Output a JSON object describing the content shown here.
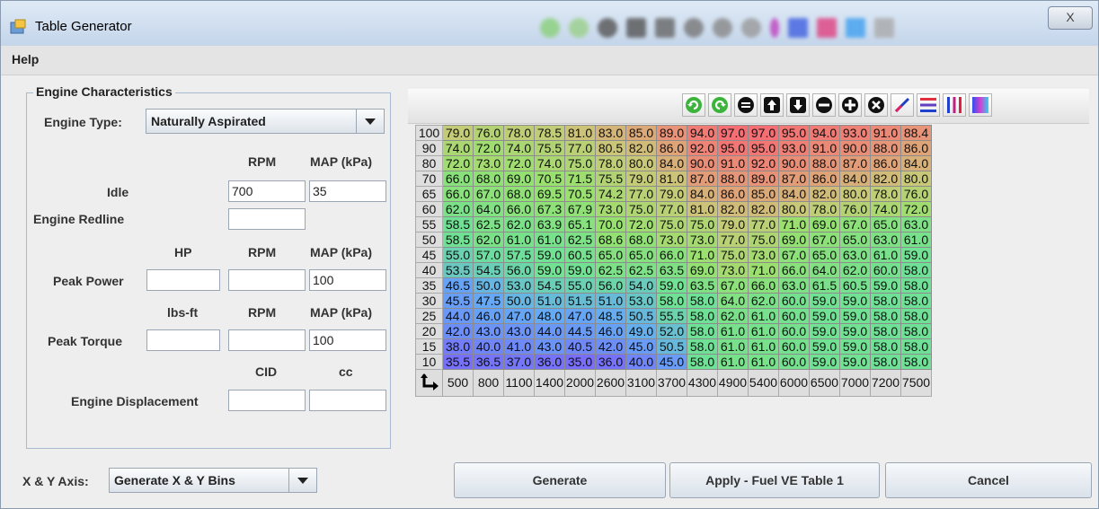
{
  "window": {
    "title": "Table Generator",
    "close_glyph": "X"
  },
  "menu": {
    "help": "Help"
  },
  "engine": {
    "group_title": "Engine Characteristics",
    "engine_type_label": "Engine Type:",
    "engine_type_value": "Naturally Aspirated",
    "col_rpm": "RPM",
    "col_map": "MAP (kPa)",
    "col_hp": "HP",
    "col_lbsft": "lbs-ft",
    "col_cid": "CID",
    "col_cc": "cc",
    "idle_label": "Idle",
    "idle_rpm": "700",
    "idle_map": "35",
    "redline_label": "Engine Redline",
    "redline_rpm": "",
    "peak_power_label": "Peak Power",
    "peak_power_hp": "",
    "peak_power_rpm": "",
    "peak_power_map": "100",
    "peak_torque_label": "Peak Torque",
    "peak_torque_lbsft": "",
    "peak_torque_rpm": "",
    "peak_torque_map": "100",
    "displacement_label": "Engine Displacement",
    "displacement_cid": "",
    "displacement_cc": ""
  },
  "axis": {
    "label": "X & Y Axis:",
    "value": "Generate X & Y Bins"
  },
  "buttons": {
    "generate": "Generate",
    "apply": "Apply - Fuel VE Table 1",
    "cancel": "Cancel"
  },
  "toolbar_icons": [
    "rotate-left-icon",
    "rotate-right-icon",
    "equal-icon",
    "arrow-up-icon",
    "arrow-down-icon",
    "minus-icon",
    "plus-icon",
    "multiply-icon",
    "interpolate-pen-icon",
    "horizontal-lines-icon",
    "vertical-lines-icon",
    "color-gradient-icon"
  ],
  "table": {
    "y_bins": [
      "100",
      "90",
      "80",
      "70",
      "65",
      "60",
      "55",
      "50",
      "45",
      "40",
      "35",
      "30",
      "25",
      "20",
      "15",
      "10"
    ],
    "x_bins": [
      "500",
      "800",
      "1100",
      "1400",
      "2000",
      "2600",
      "3100",
      "3700",
      "4300",
      "4900",
      "5400",
      "6000",
      "6500",
      "7000",
      "7200",
      "7500"
    ],
    "rows": [
      [
        "79.0",
        "76.0",
        "78.0",
        "78.5",
        "81.0",
        "83.0",
        "85.0",
        "89.0",
        "94.0",
        "97.0",
        "97.0",
        "95.0",
        "94.0",
        "93.0",
        "91.0",
        "88.4"
      ],
      [
        "74.0",
        "72.0",
        "74.0",
        "75.5",
        "77.0",
        "80.5",
        "82.0",
        "86.0",
        "92.0",
        "95.0",
        "95.0",
        "93.0",
        "91.0",
        "90.0",
        "88.0",
        "86.0"
      ],
      [
        "72.0",
        "73.0",
        "72.0",
        "74.0",
        "75.0",
        "78.0",
        "80.0",
        "84.0",
        "90.0",
        "91.0",
        "92.0",
        "90.0",
        "88.0",
        "87.0",
        "86.0",
        "84.0"
      ],
      [
        "66.0",
        "68.0",
        "69.0",
        "70.5",
        "71.5",
        "75.5",
        "79.0",
        "81.0",
        "87.0",
        "88.0",
        "89.0",
        "87.0",
        "86.0",
        "84.0",
        "82.0",
        "80.0"
      ],
      [
        "66.0",
        "67.0",
        "68.0",
        "69.5",
        "70.5",
        "74.2",
        "77.0",
        "79.0",
        "84.0",
        "86.0",
        "85.0",
        "84.0",
        "82.0",
        "80.0",
        "78.0",
        "76.0"
      ],
      [
        "62.0",
        "64.0",
        "66.0",
        "67.3",
        "67.9",
        "73.0",
        "75.0",
        "77.0",
        "81.0",
        "82.0",
        "82.0",
        "80.0",
        "78.0",
        "76.0",
        "74.0",
        "72.0"
      ],
      [
        "58.5",
        "62.5",
        "62.0",
        "63.9",
        "65.1",
        "70.0",
        "72.0",
        "75.0",
        "75.0",
        "79.0",
        "77.0",
        "71.0",
        "69.0",
        "67.0",
        "65.0",
        "63.0"
      ],
      [
        "58.5",
        "62.0",
        "61.0",
        "61.0",
        "62.5",
        "68.6",
        "68.0",
        "73.0",
        "73.0",
        "77.0",
        "75.0",
        "69.0",
        "67.0",
        "65.0",
        "63.0",
        "61.0"
      ],
      [
        "55.0",
        "57.0",
        "57.5",
        "59.0",
        "60.5",
        "65.0",
        "65.0",
        "66.0",
        "71.0",
        "75.0",
        "73.0",
        "67.0",
        "65.0",
        "63.0",
        "61.0",
        "59.0"
      ],
      [
        "53.5",
        "54.5",
        "56.0",
        "59.0",
        "59.0",
        "62.5",
        "62.5",
        "63.5",
        "69.0",
        "73.0",
        "71.0",
        "66.0",
        "64.0",
        "62.0",
        "60.0",
        "58.0"
      ],
      [
        "46.5",
        "50.0",
        "53.0",
        "54.5",
        "55.0",
        "56.0",
        "54.0",
        "59.0",
        "63.5",
        "67.0",
        "66.0",
        "63.0",
        "61.5",
        "60.5",
        "59.0",
        "58.0"
      ],
      [
        "45.5",
        "47.5",
        "50.0",
        "51.0",
        "51.5",
        "51.0",
        "53.0",
        "58.0",
        "58.0",
        "64.0",
        "62.0",
        "60.0",
        "59.0",
        "59.0",
        "58.0",
        "58.0"
      ],
      [
        "44.0",
        "46.0",
        "47.0",
        "48.0",
        "47.0",
        "48.5",
        "50.5",
        "55.5",
        "58.0",
        "62.0",
        "61.0",
        "60.0",
        "59.0",
        "59.0",
        "58.0",
        "58.0"
      ],
      [
        "42.0",
        "43.0",
        "43.0",
        "44.0",
        "44.5",
        "46.0",
        "49.0",
        "52.0",
        "58.0",
        "61.0",
        "61.0",
        "60.0",
        "59.0",
        "59.0",
        "58.0",
        "58.0"
      ],
      [
        "38.0",
        "40.0",
        "41.0",
        "43.0",
        "40.5",
        "42.0",
        "45.0",
        "50.5",
        "58.0",
        "61.0",
        "61.0",
        "60.0",
        "59.0",
        "59.0",
        "58.0",
        "58.0"
      ],
      [
        "35.5",
        "36.5",
        "37.0",
        "36.0",
        "35.0",
        "36.0",
        "40.0",
        "45.0",
        "58.0",
        "61.0",
        "61.0",
        "60.0",
        "59.0",
        "59.0",
        "58.0",
        "58.0"
      ]
    ]
  }
}
